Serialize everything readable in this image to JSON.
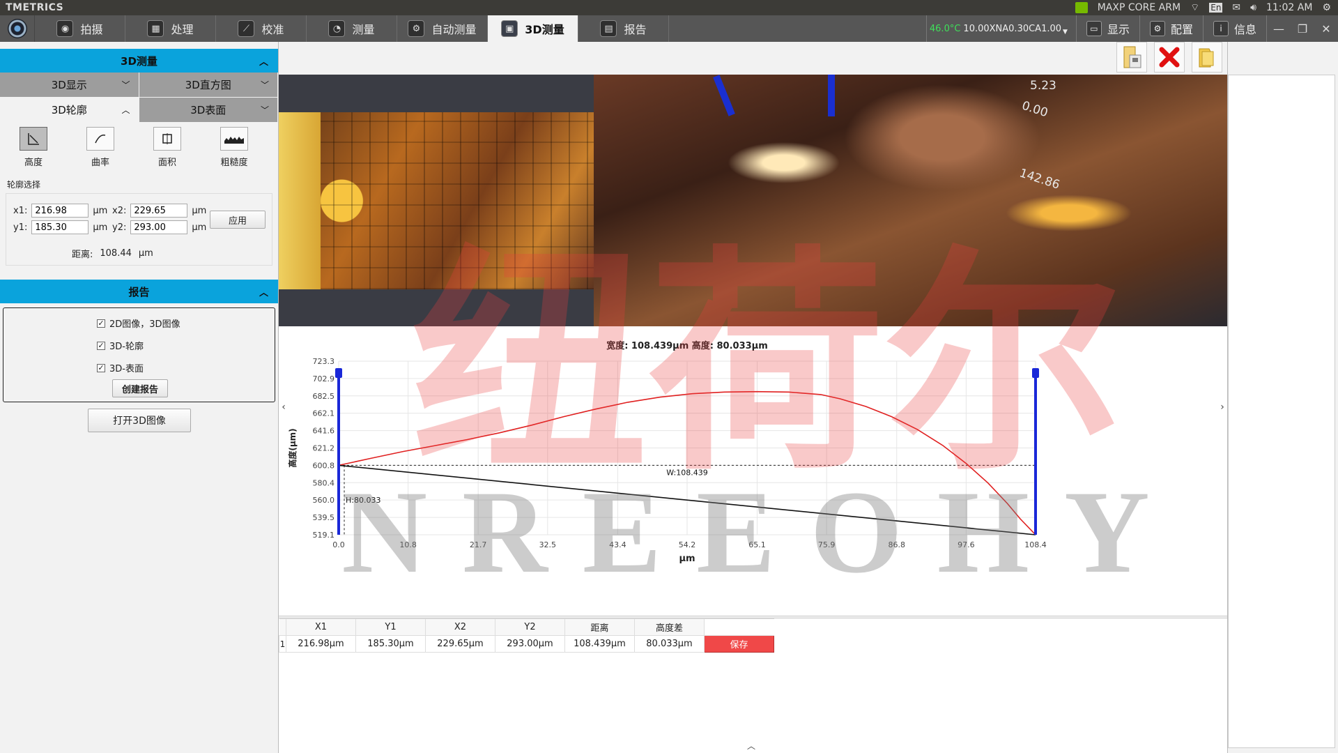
{
  "sysbar": {
    "app_name": "TMETRICS",
    "device": "MAXP CORE ARM",
    "lang": "En",
    "time": "11:02 AM"
  },
  "toolbar": {
    "tabs": [
      {
        "label": "拍摄",
        "icon": "camera-icon"
      },
      {
        "label": "处理",
        "icon": "image-process-icon"
      },
      {
        "label": "校准",
        "icon": "ruler-icon"
      },
      {
        "label": "测量",
        "icon": "measure-icon"
      },
      {
        "label": "自动测量",
        "icon": "gears-icon"
      },
      {
        "label": "3D测量",
        "icon": "3d-chip-icon"
      },
      {
        "label": "报告",
        "icon": "report-icon"
      }
    ],
    "active_tab": "3D测量",
    "temperature": "46.0°C",
    "objective": "10.00XNA0.30CA1.00",
    "display_label": "显示",
    "config_label": "配置",
    "info_label": "信息"
  },
  "left": {
    "section_3d": "3D测量",
    "subtabs": [
      "3D显示",
      "3D直方图",
      "3D轮廓",
      "3D表面"
    ],
    "tools": [
      "高度",
      "曲率",
      "面积",
      "粗糙度"
    ],
    "profile_label": "轮廓选择",
    "x1_label": "x1:",
    "x1_value": "216.98",
    "x2_label": "x2:",
    "x2_value": "229.65",
    "y1_label": "y1:",
    "y1_value": "185.30",
    "y2_label": "y2:",
    "y2_value": "293.00",
    "unit": "μm",
    "apply_label": "应用",
    "distance_label": "距离:",
    "distance_value": "108.44",
    "distance_unit": "μm",
    "section_report": "报告",
    "checks": [
      "2D图像，3D图像",
      "3D-轮廓",
      "3D-表面"
    ],
    "create_report_label": "创建报告",
    "open_3d_label": "打开3D图像"
  },
  "view3d": {
    "axis_labels": [
      "5.23",
      "0.00",
      "142.86"
    ]
  },
  "chart_data": {
    "type": "line",
    "title": "宽度: 108.439μm 高度: 80.033μm",
    "xlabel": "μm",
    "ylabel": "高度(μm)",
    "xlim": [
      0.0,
      108.4
    ],
    "ylim": [
      519.1,
      723.3
    ],
    "xticks": [
      "0.0",
      "10.8",
      "21.7",
      "32.5",
      "43.4",
      "54.2",
      "65.1",
      "75.9",
      "86.8",
      "97.6",
      "108.4"
    ],
    "yticks": [
      "723.3",
      "702.9",
      "682.5",
      "662.1",
      "641.6",
      "621.2",
      "600.8",
      "580.4",
      "560.0",
      "539.5",
      "519.1"
    ],
    "grid": true,
    "series": [
      {
        "color": "#e02020",
        "x": [
          0,
          5,
          10,
          15,
          20,
          25,
          30,
          35,
          40,
          45,
          50,
          55,
          60,
          65,
          70,
          75,
          78,
          82,
          86,
          90,
          94,
          97.6,
          101,
          104,
          106,
          108.4
        ],
        "y": [
          600.8,
          609,
          617,
          624,
          631,
          639,
          648,
          658,
          667,
          675,
          681,
          685,
          687,
          687.5,
          687,
          684,
          679,
          670,
          658,
          643,
          624,
          603,
          580,
          556,
          538,
          519.1
        ]
      },
      {
        "color": "#111111",
        "x": [
          0,
          108.4
        ],
        "y": [
          600.8,
          519.1
        ]
      }
    ],
    "annotations": [
      {
        "text": "W:108.439"
      },
      {
        "text": "H:80.033"
      }
    ],
    "cursor_color": "#1a28d8"
  },
  "table": {
    "headers": [
      "X1",
      "Y1",
      "X2",
      "Y2",
      "距离",
      "高度差"
    ],
    "rows": [
      {
        "index": "1",
        "cells": [
          "216.98μm",
          "185.30μm",
          "229.65μm",
          "293.00μm",
          "108.439μm",
          "80.033μm"
        ],
        "action": "保存"
      }
    ]
  },
  "watermark": {
    "line1": "纽荷尔",
    "line2": "NREEOHY"
  },
  "colors": {
    "accent": "#0aa3dc",
    "toolbar": "#565656",
    "save": "#f04848"
  }
}
